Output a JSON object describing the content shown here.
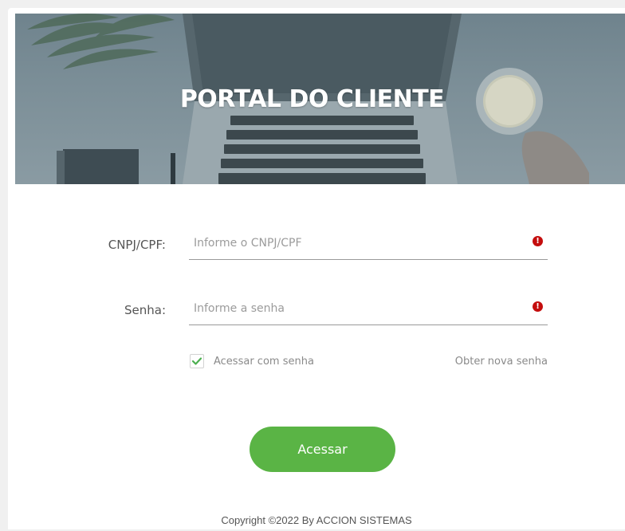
{
  "hero": {
    "title": "PORTAL DO CLIENTE"
  },
  "form": {
    "cnpj": {
      "label": "CNPJ/CPF:",
      "placeholder": "Informe o CNPJ/CPF",
      "value": "",
      "status_icon": "exclamation-circle-icon"
    },
    "password": {
      "label": "Senha:",
      "placeholder": "Informe a senha",
      "value": "",
      "status_icon": "exclamation-circle-icon"
    },
    "remember": {
      "label": "Acessar com senha",
      "checked": true
    },
    "new_password_link": "Obter nova senha",
    "submit_label": "Acessar"
  },
  "footer": {
    "copyright": "Copyright ©2022 By ACCION SISTEMAS"
  },
  "colors": {
    "accent_green": "#5ab445",
    "error_red": "#c40d0d",
    "hero_overlay": "#7b8e97"
  }
}
